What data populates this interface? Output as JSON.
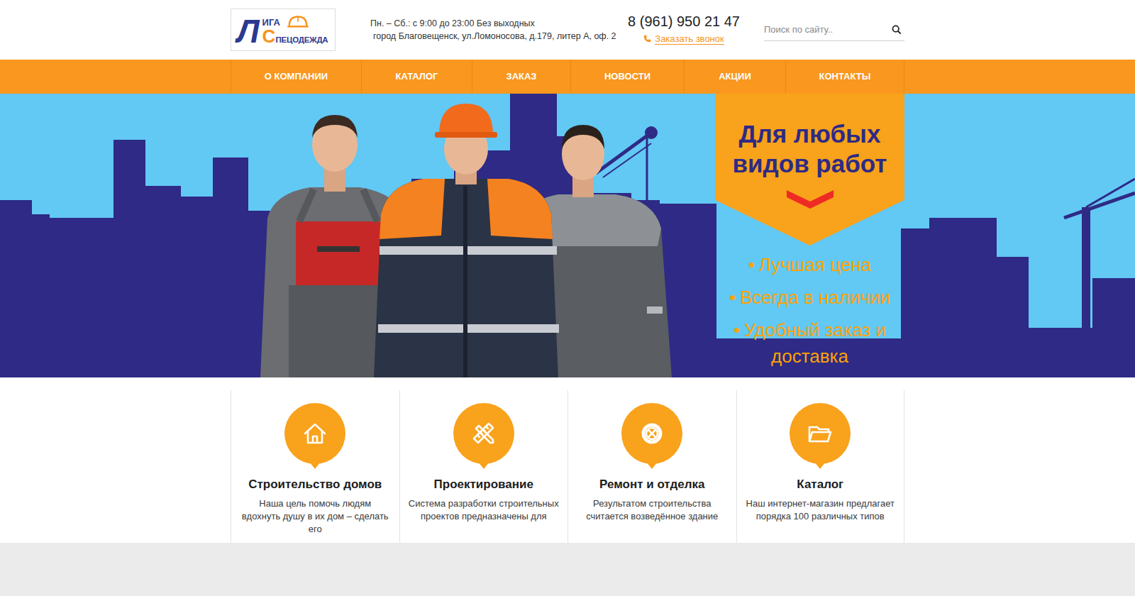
{
  "logo": {
    "letter_1": "Л",
    "text_1": "ИГА",
    "letter_2": "С",
    "text_2": "ПЕЦОДЕЖДА"
  },
  "header": {
    "hours": "Пн. – Сб.: с 9:00 до 23:00 Без выходных",
    "address": "город Благовещенск, ул.Ломоносова, д.179, литер А, оф. 2",
    "phone": "8 (961) 950 21 47",
    "callback": "Заказать звонок"
  },
  "search": {
    "placeholder": "Поиск по сайту.."
  },
  "nav": [
    "О КОМПАНИИ",
    "КАТАЛОГ",
    "ЗАКАЗ",
    "НОВОСТИ",
    "АКЦИИ",
    "КОНТАКТЫ"
  ],
  "hero": {
    "title": "Для любых видов работ",
    "bullets": [
      {
        "marker": "•",
        "text": "Лучшая цена"
      },
      {
        "marker": "•",
        "text": "Всегда в наличии"
      },
      {
        "marker": "•",
        "text": "Удобный заказ и доставка"
      }
    ]
  },
  "features": [
    {
      "title": "Строительство домов",
      "text": "Наша цель помочь людям вдохнуть душу в их дом – сделать его"
    },
    {
      "title": "Проектирование",
      "text": "Система разработки строительных проектов предназначены для"
    },
    {
      "title": "Ремонт и отделка",
      "text": "Результатом строительства считается возведённое здание"
    },
    {
      "title": "Каталог",
      "text": "Наш интернет-магазин предлагает порядка 100 различных типов"
    }
  ]
}
